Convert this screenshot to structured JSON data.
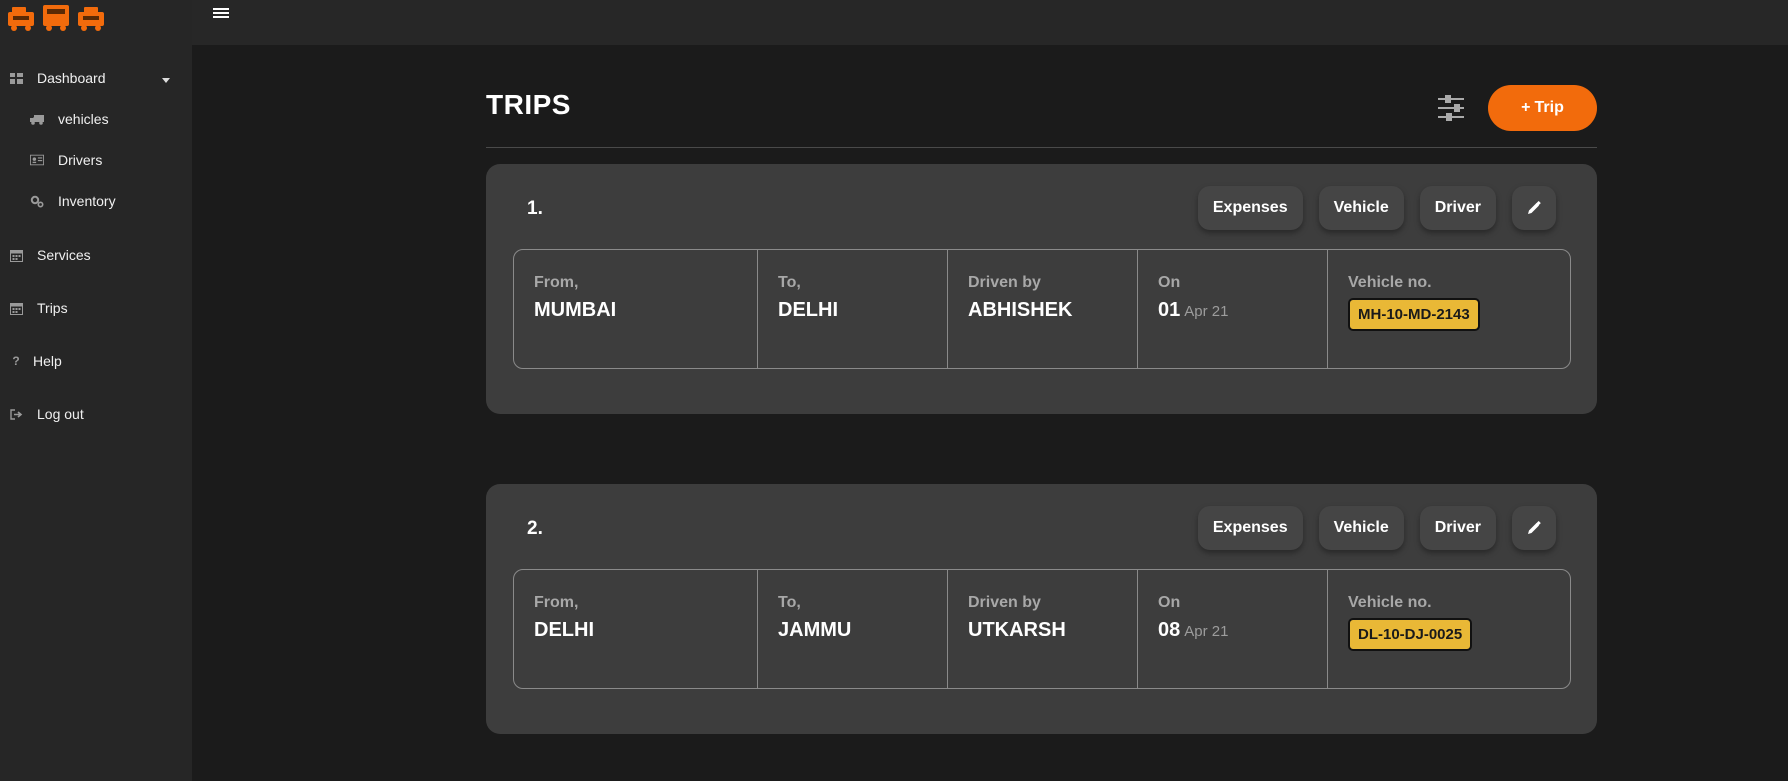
{
  "sidebar": {
    "items": [
      {
        "label": "Dashboard",
        "icon": "dashboard-icon"
      },
      {
        "label": "vehicles",
        "icon": "truck-icon"
      },
      {
        "label": "Drivers",
        "icon": "id-card-icon"
      },
      {
        "label": "Inventory",
        "icon": "gears-icon"
      },
      {
        "label": "Services",
        "icon": "calendar-icon"
      },
      {
        "label": "Trips",
        "icon": "calendar-icon"
      },
      {
        "label": "Help",
        "icon": "question-icon"
      },
      {
        "label": "Log out",
        "icon": "logout-icon"
      }
    ]
  },
  "header": {
    "title": "TRIPS",
    "add_button_label": "Trip",
    "add_button_icon": "+"
  },
  "trip_labels": {
    "from": "From,",
    "to": "To,",
    "driven_by": "Driven by",
    "on": "On",
    "vehicle_no": "Vehicle no.",
    "expenses": "Expenses",
    "vehicle": "Vehicle",
    "driver": "Driver"
  },
  "trips": [
    {
      "number": "1.",
      "from": "MUMBAI",
      "to": "DELHI",
      "driver": "ABHISHEK",
      "day": "01",
      "month": "Apr 21",
      "vehicle": "MH-10-MD-2143"
    },
    {
      "number": "2.",
      "from": "DELHI",
      "to": "JAMMU",
      "driver": "UTKARSH",
      "day": "08",
      "month": "Apr 21",
      "vehicle": "DL-10-DJ-0025"
    }
  ],
  "colors": {
    "accent": "#f26b0c",
    "plate": "#e9b836"
  }
}
